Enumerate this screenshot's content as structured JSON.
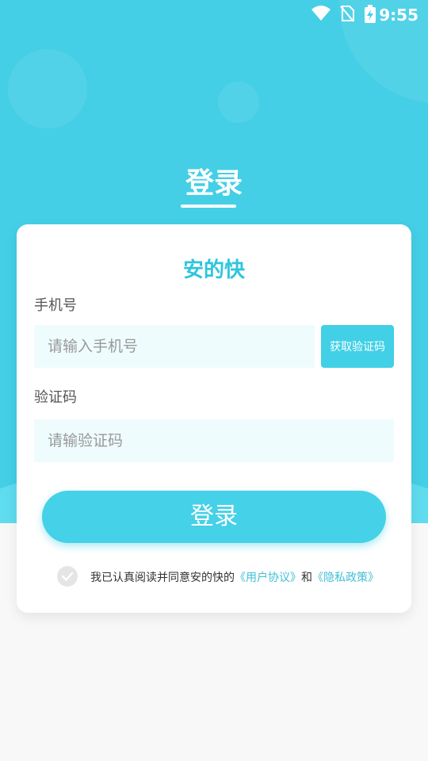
{
  "status_bar": {
    "time": "9:55"
  },
  "header": {
    "title": "登录"
  },
  "card": {
    "brand": "安的快",
    "phone": {
      "label": "手机号",
      "placeholder": "请输入手机号",
      "value": ""
    },
    "code_button_label": "获取验证码",
    "code": {
      "label": "验证码",
      "placeholder": "请输验证码",
      "value": ""
    },
    "login_button_label": "登录",
    "agreement": {
      "text": "我已认真阅读并同意安的快的",
      "user_agreement": "《用户协议》",
      "connector": "和",
      "privacy_policy": "《隐私政策》"
    }
  },
  "colors": {
    "primary": "#44cfe6",
    "link": "#3fbfd6"
  },
  "icons": [
    "wifi-icon",
    "no-sim-icon",
    "battery-charging-icon",
    "check-icon"
  ]
}
